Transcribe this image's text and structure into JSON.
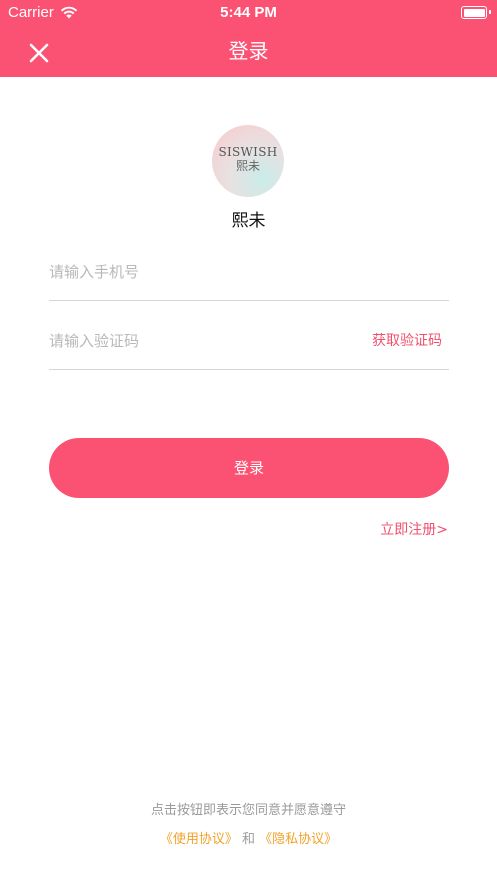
{
  "status_bar": {
    "carrier": "Carrier",
    "time": "5:44 PM"
  },
  "nav": {
    "title": "登录",
    "close_icon": "close-icon"
  },
  "logo": {
    "brand": "SISWISH",
    "brand_cn": "熙未"
  },
  "app_name": "熙未",
  "form": {
    "phone_placeholder": "请输入手机号",
    "phone_value": "",
    "code_placeholder": "请输入验证码",
    "code_value": "",
    "get_code_label": "获取验证码"
  },
  "login_button": "登录",
  "register_link": "立即注册>",
  "terms": {
    "notice": "点击按钮即表示您同意并愿意遵守",
    "user_agreement": "《使用协议》",
    "conjunction": "和",
    "privacy_policy": "《隐私协议》"
  },
  "colors": {
    "brand": "#fb5273",
    "link": "#f0506e",
    "agreement": "#f2a22a"
  }
}
